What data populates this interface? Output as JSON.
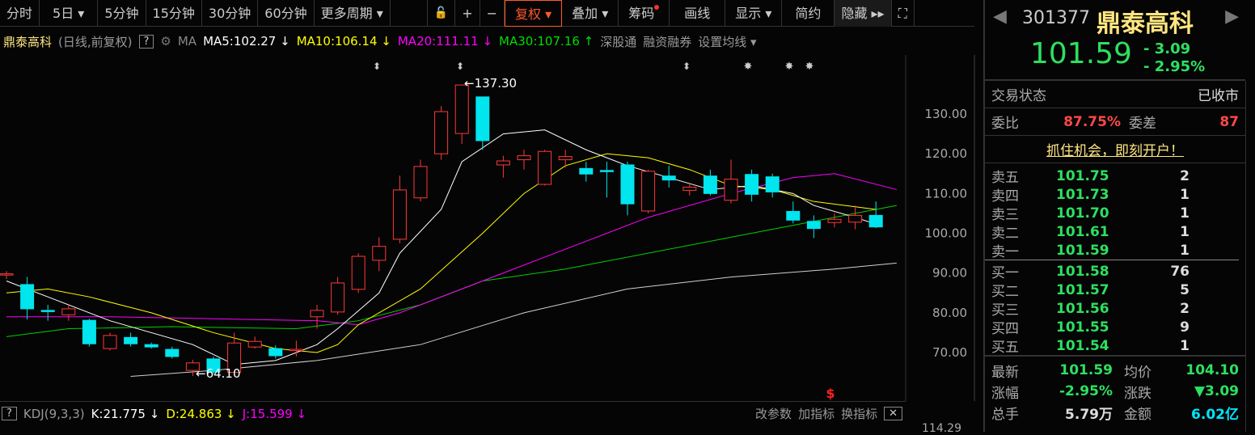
{
  "toolbar": {
    "items": [
      "分时",
      "5日 ▾",
      "5分钟",
      "15分钟",
      "30分钟",
      "60分钟",
      "更多周期 ▾"
    ],
    "lock": "🔓",
    "plus": "+",
    "minus": "−",
    "fuquan": "复权 ▾",
    "diejia": "叠加 ▾",
    "chouma": "筹码",
    "huaxian": "画线",
    "xianshi": "显示 ▾",
    "jianyue": "简约",
    "yincang": "隐藏 ▸▸",
    "fullscreen": "⛶"
  },
  "info": {
    "name": "鼎泰高科",
    "mode": "(日线,前复权)",
    "help": "?",
    "ma": "MA",
    "ma5": "MA5:102.27 ↓",
    "ma10": "MA10:106.14 ↓",
    "ma20": "MA20:111.11 ↓",
    "ma30": "MA30:107.16 ↑",
    "sgt": "深股通",
    "rzrq": "融资融券",
    "setma": "设置均线 ▾"
  },
  "chart_labels": {
    "high": "←137.30",
    "low": "←64.10",
    "dollar": "$"
  },
  "colors": {
    "up": "#ff3838",
    "down": "#00e5ee",
    "ma5": "#ffffff",
    "ma10": "#ffff00",
    "ma20": "#ff00ff",
    "ma30": "#00d000",
    "ma60": "#d0d0d0"
  },
  "chart_data": {
    "type": "candlestick",
    "ylim": [
      61,
      145
    ],
    "yticks": [
      "130.00",
      "120.00",
      "110.00",
      "100.00",
      "90.00",
      "80.00",
      "70.00"
    ],
    "candles": [
      [
        89.5,
        89.8,
        90.5,
        88.5
      ],
      [
        87.1,
        81,
        89,
        78.3
      ],
      [
        80.6,
        80.4,
        82,
        78
      ],
      [
        79.5,
        81,
        82,
        78
      ],
      [
        78.1,
        72.2,
        78.5,
        71.5
      ],
      [
        71,
        74.3,
        75,
        70.5
      ],
      [
        73.8,
        72.2,
        75,
        71.5
      ],
      [
        72,
        71.4,
        72.5,
        71
      ],
      [
        70.8,
        69,
        71.5,
        68.5
      ],
      [
        65.5,
        67.4,
        68.2,
        64.1
      ],
      [
        68.4,
        65.1,
        69,
        64.5
      ],
      [
        65,
        72.4,
        75,
        64.8
      ],
      [
        71.4,
        72.8,
        74,
        71
      ],
      [
        71,
        69.2,
        71.8,
        68.5
      ],
      [
        70.5,
        70.8,
        73,
        69
      ],
      [
        79,
        80.6,
        82,
        76
      ],
      [
        80.2,
        87.5,
        89,
        79.5
      ],
      [
        85.9,
        94.2,
        95,
        85
      ],
      [
        93.2,
        96.7,
        99,
        90.5
      ],
      [
        98.5,
        110.9,
        114.5,
        97.5
      ],
      [
        108.9,
        116.8,
        118.5,
        108
      ],
      [
        120,
        130.6,
        132,
        118.5
      ],
      [
        125.1,
        137.3,
        137.3,
        122.5
      ],
      [
        134.3,
        123.3,
        134.3,
        121
      ],
      [
        117.2,
        118.2,
        119.5,
        114
      ],
      [
        118.5,
        119.5,
        121,
        116
      ],
      [
        112.3,
        120.6,
        121,
        112
      ],
      [
        118.5,
        119.3,
        121,
        116.5
      ],
      [
        116.3,
        114.9,
        118,
        113
      ],
      [
        115.8,
        115.6,
        118,
        109
      ],
      [
        117.2,
        107.4,
        118,
        104.5
      ],
      [
        105.6,
        115.6,
        116,
        105
      ],
      [
        114.4,
        113.4,
        117,
        111.5
      ],
      [
        110.8,
        111.6,
        112.5,
        109.5
      ],
      [
        114.4,
        110,
        116,
        109.5
      ],
      [
        108.3,
        113.6,
        118.5,
        107.5
      ],
      [
        114.8,
        109.8,
        116,
        108
      ],
      [
        114.2,
        110.4,
        115,
        109
      ],
      [
        105.5,
        103.3,
        108,
        102.5
      ],
      [
        103,
        101.2,
        104.5,
        98.8
      ],
      [
        102.7,
        103.5,
        105,
        101.5
      ],
      [
        102.8,
        104.5,
        107,
        101
      ],
      [
        104.5,
        101.59,
        108,
        101.3
      ]
    ],
    "ma": {
      "ma5": [
        [
          0,
          88
        ],
        [
          2,
          84
        ],
        [
          5,
          78
        ],
        [
          9,
          72
        ],
        [
          11,
          67
        ],
        [
          13,
          68
        ],
        [
          15,
          72
        ],
        [
          16,
          76
        ],
        [
          18,
          85
        ],
        [
          19,
          95
        ],
        [
          21,
          106
        ],
        [
          22,
          118
        ],
        [
          24,
          125
        ],
        [
          26,
          126
        ],
        [
          28,
          121
        ],
        [
          30,
          117
        ],
        [
          32,
          114
        ],
        [
          34,
          111
        ],
        [
          36,
          112
        ],
        [
          38,
          110
        ],
        [
          39,
          107
        ],
        [
          41,
          104
        ],
        [
          42,
          102.3
        ]
      ],
      "ma10": [
        [
          0,
          85
        ],
        [
          2,
          86
        ],
        [
          4,
          84
        ],
        [
          7,
          80
        ],
        [
          10,
          75
        ],
        [
          13,
          71
        ],
        [
          15,
          70
        ],
        [
          16,
          72
        ],
        [
          17,
          77
        ],
        [
          20,
          86
        ],
        [
          23,
          100
        ],
        [
          25,
          110
        ],
        [
          27,
          117
        ],
        [
          29,
          120
        ],
        [
          31,
          119
        ],
        [
          33,
          116
        ],
        [
          35,
          112
        ],
        [
          37,
          111
        ],
        [
          39,
          108
        ],
        [
          42,
          106
        ]
      ],
      "ma20": [
        [
          0,
          79
        ],
        [
          5,
          79
        ],
        [
          10,
          78.5
        ],
        [
          15,
          78
        ],
        [
          17,
          77
        ],
        [
          19,
          80
        ],
        [
          23,
          88
        ],
        [
          27,
          96
        ],
        [
          31,
          104
        ],
        [
          35,
          110
        ],
        [
          38,
          114
        ],
        [
          40,
          115
        ],
        [
          43,
          111
        ]
      ],
      "ma30": [
        [
          0,
          74
        ],
        [
          3,
          76
        ],
        [
          8,
          76.5
        ],
        [
          14,
          76
        ],
        [
          17,
          78
        ],
        [
          20,
          82
        ],
        [
          23,
          88
        ],
        [
          27,
          91
        ],
        [
          31,
          95
        ],
        [
          35,
          99
        ],
        [
          39,
          103
        ],
        [
          43,
          107
        ]
      ],
      "ma60": [
        [
          6,
          64
        ],
        [
          10,
          65.5
        ],
        [
          15,
          68
        ],
        [
          20,
          72
        ],
        [
          25,
          80
        ],
        [
          30,
          86
        ],
        [
          35,
          89
        ],
        [
          40,
          91
        ],
        [
          43,
          92.5
        ]
      ]
    }
  },
  "kdj": {
    "help": "?",
    "name": "KDJ(9,3,3)",
    "k": "K:21.775 ↓",
    "d": "D:24.863 ↓",
    "j": "J:15.599 ↓",
    "gaicanshu": "改参数",
    "jiazhibiao": "加指标",
    "huanzhibiao": "换指标",
    "close": "✕",
    "axis_value": "114.29"
  },
  "quote": {
    "code": "301377",
    "name": "鼎泰高科",
    "price": "101.59",
    "change": "- 3.09",
    "pct": "- 2.95%",
    "status_label": "交易状态",
    "status": "已收市",
    "weibi_label": "委比",
    "weibi": "87.75%",
    "weicha_label": "委差",
    "weicha": "87",
    "ad": "抓住机会，即刻开户！",
    "asks": [
      {
        "l": "卖五",
        "p": "101.75",
        "v": "2"
      },
      {
        "l": "卖四",
        "p": "101.73",
        "v": "1"
      },
      {
        "l": "卖三",
        "p": "101.70",
        "v": "1"
      },
      {
        "l": "卖二",
        "p": "101.61",
        "v": "1"
      },
      {
        "l": "卖一",
        "p": "101.59",
        "v": "1"
      }
    ],
    "bids": [
      {
        "l": "买一",
        "p": "101.58",
        "v": "76"
      },
      {
        "l": "买二",
        "p": "101.57",
        "v": "5"
      },
      {
        "l": "买三",
        "p": "101.56",
        "v": "2"
      },
      {
        "l": "买四",
        "p": "101.55",
        "v": "9"
      },
      {
        "l": "买五",
        "p": "101.54",
        "v": "1"
      }
    ],
    "stats": [
      {
        "l": "最新",
        "v": "101.59",
        "l2": "均价",
        "v2": "104.10"
      },
      {
        "l": "涨幅",
        "v": "-2.95%",
        "l2": "涨跌",
        "v2": "▼3.09"
      },
      {
        "l": "总手",
        "v": "5.79万",
        "l2": "金额",
        "v2": "6.02亿"
      }
    ]
  }
}
